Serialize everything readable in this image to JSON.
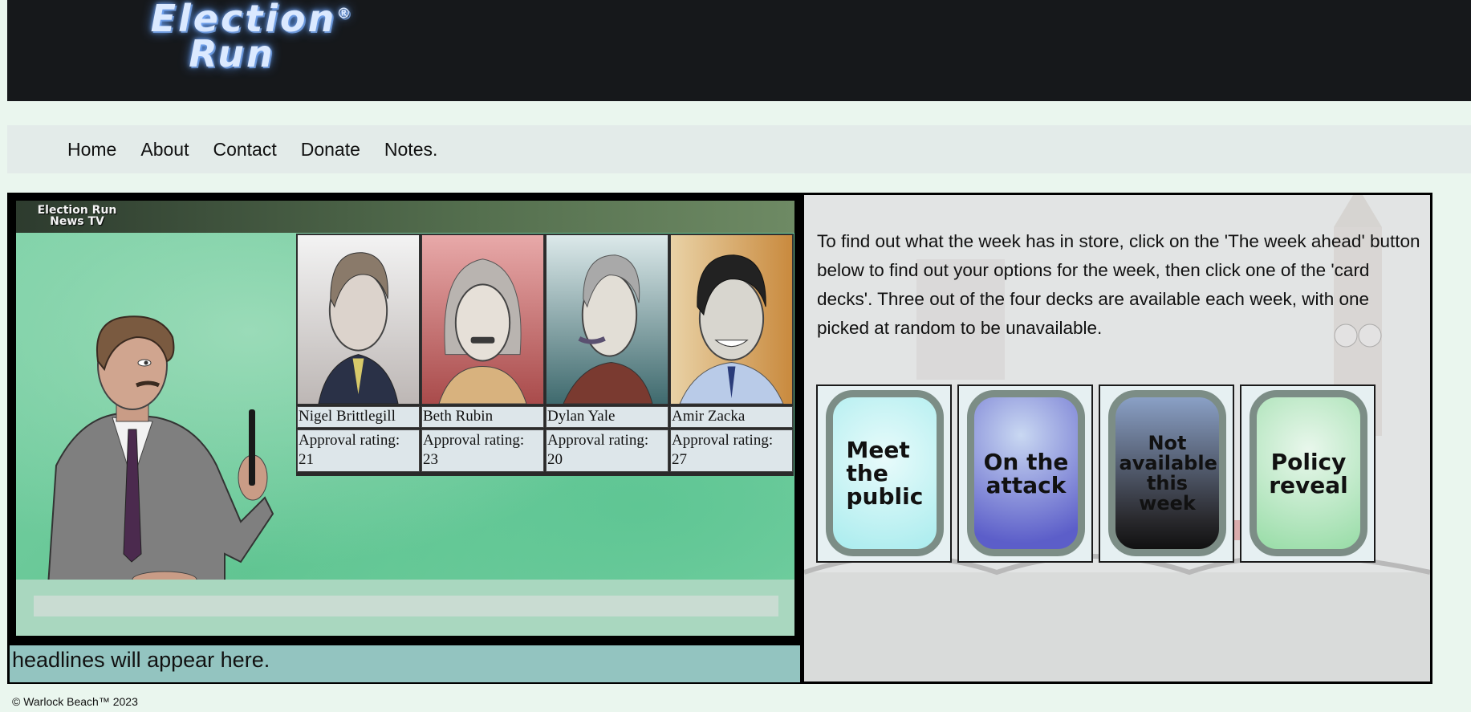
{
  "logo": {
    "line1": "Election",
    "mark": "®",
    "line2": "Run"
  },
  "nav": {
    "items": [
      "Home",
      "About",
      "Contact",
      "Donate",
      "Notes."
    ]
  },
  "tv": {
    "channel_logo": {
      "line1": "Election Run",
      "line2": "News TV"
    },
    "candidates": [
      {
        "name": "Nigel Brittlegill",
        "approval_label": "Approval rating:",
        "approval": "21"
      },
      {
        "name": "Beth Rubin",
        "approval_label": "Approval rating:",
        "approval": "23"
      },
      {
        "name": "Dylan Yale",
        "approval_label": "Approval rating:",
        "approval": "20"
      },
      {
        "name": "Amir Zacka",
        "approval_label": "Approval rating:",
        "approval": "27"
      }
    ]
  },
  "headline": "headlines will appear here.",
  "intro": "To find out what the week has in store, click on the 'The week ahead' button below to find out your options for the week, then click one of the 'card decks'. Three out of the four decks are available each week, with one picked at random to be unavailable.",
  "decks": [
    {
      "label": "Meet the public",
      "colors": [
        "#e8fbfb",
        "#a9ecee"
      ]
    },
    {
      "label": "On the attack",
      "colors": [
        "#c9d8f2",
        "#5c5ec9"
      ]
    },
    {
      "label": "Not available this week",
      "colors": [
        "#8aa0c6",
        "#111111"
      ]
    },
    {
      "label": "Policy reveal",
      "colors": [
        "#e9f7ec",
        "#97dca6"
      ]
    }
  ],
  "footer": "© Warlock Beach™ 2023"
}
